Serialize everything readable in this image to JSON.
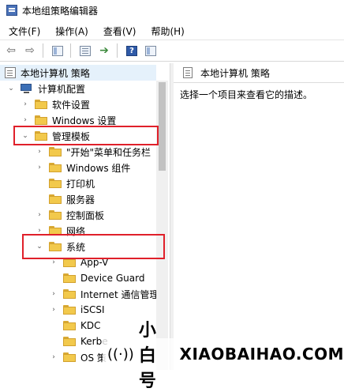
{
  "window": {
    "title": "本地组策略编辑器"
  },
  "menu": [
    {
      "label": "文件(F)"
    },
    {
      "label": "操作(A)"
    },
    {
      "label": "查看(V)"
    },
    {
      "label": "帮助(H)"
    }
  ],
  "toolbar": {
    "back_glyph": "⇦",
    "forward_glyph": "⇨",
    "help_glyph": "?",
    "export_glyph": "➔"
  },
  "tree": {
    "root": "本地计算机 策略",
    "computer_config": "计算机配置",
    "software_settings": "软件设置",
    "windows_settings": "Windows 设置",
    "admin_templates": "管理模板",
    "start_menu": "\"开始\"菜单和任务栏",
    "windows_components": "Windows 组件",
    "printers": "打印机",
    "servers": "服务器",
    "control_panel": "控制面板",
    "network": "网络",
    "system": "系统",
    "app_v": "App-V",
    "device_guard": "Device Guard",
    "internet_comm": "Internet 通信管理",
    "iscsi": "iSCSI",
    "kdc": "KDC",
    "kerberos": "Kerbe",
    "os": "OS 策"
  },
  "glyphs": {
    "expanded": "⌄",
    "collapsed": "›"
  },
  "right": {
    "header": "本地计算机 策略",
    "description": "选择一个项目来查看它的描述。"
  },
  "highlight_color": "#e0202a",
  "watermark": {
    "icon": "((·))",
    "cn": "小白号",
    "en": "XIAOBAIHAO.COM"
  }
}
